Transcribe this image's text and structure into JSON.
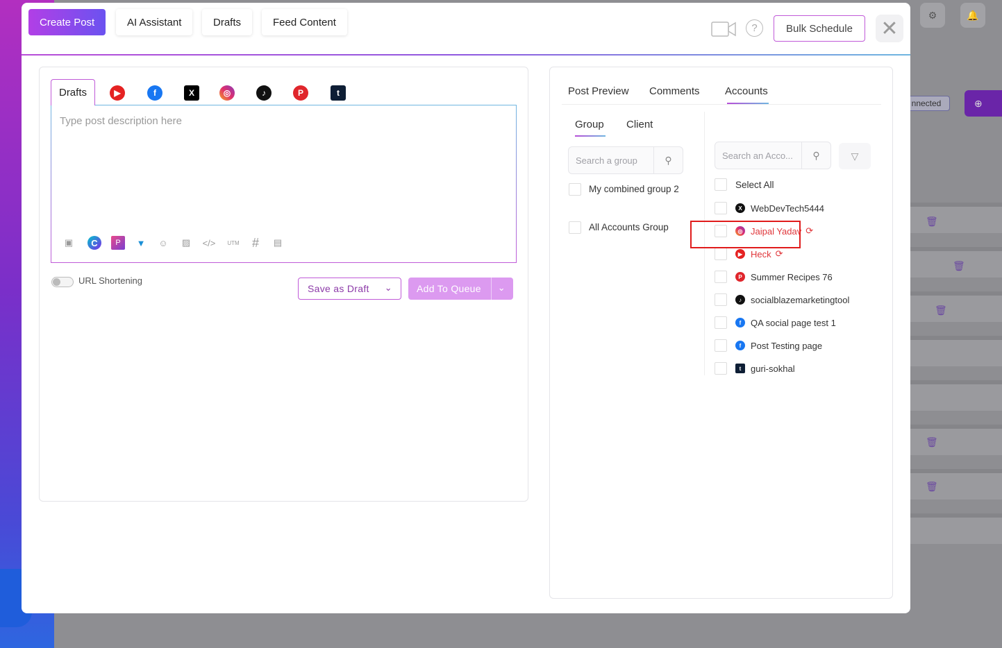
{
  "header": {
    "tabs": [
      {
        "label": "Create Post",
        "active": true
      },
      {
        "label": "AI Assistant",
        "active": false
      },
      {
        "label": "Drafts",
        "active": false
      },
      {
        "label": "Feed Content",
        "active": false
      }
    ],
    "bulk_label": "Bulk Schedule",
    "help_glyph": "?",
    "close_glyph": "✕"
  },
  "editor": {
    "drafts_tab": "Drafts",
    "platform_icons": [
      "youtube-icon",
      "facebook-icon",
      "x-icon",
      "instagram-icon",
      "tiktok-icon",
      "pinterest-icon",
      "tumblr-icon"
    ],
    "placeholder": "Type post description here",
    "utm_label": "UTM",
    "url_shortening_label": "URL Shortening",
    "save_draft_label": "Save as Draft",
    "add_queue_label": "Add To Queue"
  },
  "preview": {
    "tabs": [
      "Post Preview",
      "Comments",
      "Accounts"
    ],
    "active_tab": "Accounts",
    "group_tabs": [
      "Group",
      "Client"
    ],
    "group_search_placeholder": "Search a group",
    "groups": [
      "My combined group 2",
      "All Accounts Group"
    ],
    "account_search_placeholder": "Search an Acco...",
    "select_all_label": "Select All",
    "accounts": [
      {
        "name": "WebDevTech5444",
        "platform": "x",
        "error": false
      },
      {
        "name": "Jaipal Yadav",
        "platform": "instagram",
        "error": true
      },
      {
        "name": "Heck",
        "platform": "youtube",
        "error": true
      },
      {
        "name": "Summer Recipes 76",
        "platform": "pinterest",
        "error": false
      },
      {
        "name": "socialblazemarketingtool",
        "platform": "tiktok",
        "error": false
      },
      {
        "name": "QA social page test 1",
        "platform": "facebook",
        "error": false
      },
      {
        "name": "Post Testing page",
        "platform": "facebook",
        "error": false
      },
      {
        "name": "guri-sokhal",
        "platform": "tumblr",
        "error": false
      }
    ]
  },
  "background": {
    "badge_text": "nnected"
  },
  "colors": {
    "accent": "#b23fe6",
    "error": "#e0363a",
    "highlight": "#e01b1b"
  }
}
